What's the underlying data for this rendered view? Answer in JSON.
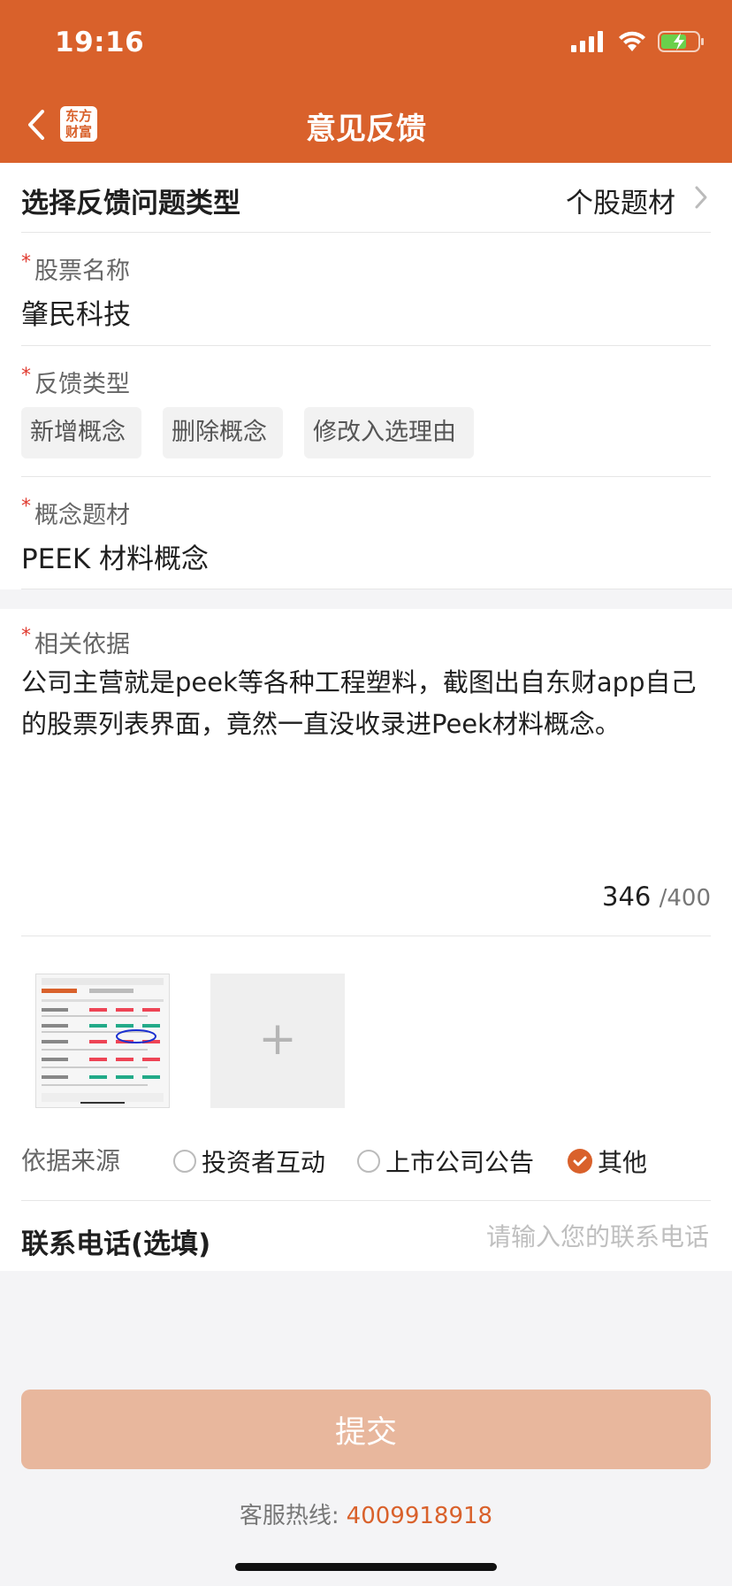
{
  "status_bar": {
    "time": "19:16"
  },
  "nav": {
    "title": "意见反馈",
    "logo_line1": "东方",
    "logo_line2": "财富"
  },
  "form": {
    "issue_type": {
      "label": "选择反馈问题类型",
      "value": "个股题材"
    },
    "stock_name": {
      "label": "股票名称",
      "value": "肇民科技"
    },
    "feedback_type": {
      "label": "反馈类型",
      "options": [
        "新增概念",
        "删除概念",
        "修改入选理由"
      ]
    },
    "concept": {
      "label": "概念题材",
      "value": "PEEK 材料概念"
    },
    "basis": {
      "label": "相关依据",
      "text": "公司主营就是peek等各种工程塑料，截图出自东财app自己的股票列表界面，竟然一直没收录进Peek材料概念。",
      "count": "346",
      "max": "/400"
    },
    "source": {
      "label": "依据来源",
      "options": [
        "投资者互动",
        "上市公司公告",
        "其他"
      ],
      "selected": "其他"
    },
    "phone": {
      "label": "联系电话(选填)",
      "placeholder": "请输入您的联系电话"
    }
  },
  "submit_label": "提交",
  "hotline": {
    "label": "客服热线:",
    "number": "4009918918"
  },
  "colors": {
    "brand": "#d9612b",
    "submit_disabled": "#e8b79d"
  }
}
